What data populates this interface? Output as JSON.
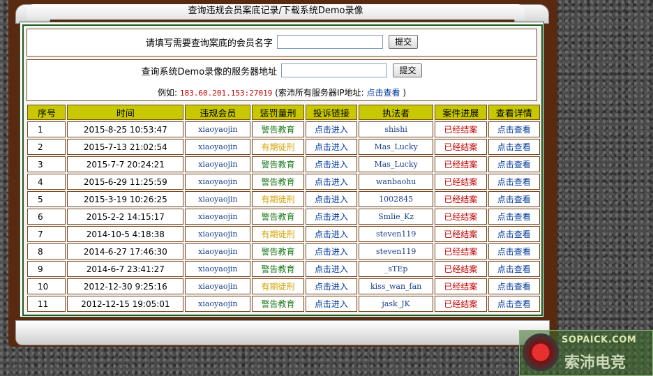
{
  "window": {
    "title": "查询违规会员案底记录/下载系统Demo录像"
  },
  "member_query": {
    "label": "请填写需要查询案底的会员名字",
    "value": "",
    "submit_label": "提交"
  },
  "demo_query": {
    "label": "查询系统Demo录像的服务器地址",
    "value": "",
    "submit_label": "提交",
    "example_prefix": "例如:",
    "example_ip": "183.60.201.153:27019",
    "example_suffix_open": "(索沛所有服务器IP地址:",
    "example_link": "点击查看",
    "example_suffix_close": ")"
  },
  "table": {
    "headers": [
      "序号",
      "时间",
      "违规会员",
      "惩罚量刑",
      "投诉链接",
      "执法者",
      "案件进展",
      "查看详情"
    ],
    "rows": [
      {
        "idx": "1",
        "time": "2015-8-25 10:53:47",
        "member": "xiaoyaojin",
        "penalty": "警告教育",
        "penalty_type": "warn",
        "complaint": "点击进入",
        "enforcer": "shishi",
        "progress": "已经结案",
        "detail": "点击查看"
      },
      {
        "idx": "2",
        "time": "2015-7-13 21:02:54",
        "member": "xiaoyaojin",
        "penalty": "有期徒刑",
        "penalty_type": "jail",
        "complaint": "点击进入",
        "enforcer": "Mas_Lucky",
        "progress": "已经结案",
        "detail": "点击查看"
      },
      {
        "idx": "3",
        "time": "2015-7-7 20:24:21",
        "member": "xiaoyaojin",
        "penalty": "警告教育",
        "penalty_type": "warn",
        "complaint": "点击进入",
        "enforcer": "Mas_Lucky",
        "progress": "已经结案",
        "detail": "点击查看"
      },
      {
        "idx": "4",
        "time": "2015-6-29 11:25:59",
        "member": "xiaoyaojin",
        "penalty": "警告教育",
        "penalty_type": "warn",
        "complaint": "点击进入",
        "enforcer": "wanbaohu",
        "progress": "已经结案",
        "detail": "点击查看"
      },
      {
        "idx": "5",
        "time": "2015-3-19 10:26:25",
        "member": "xiaoyaojin",
        "penalty": "有期徒刑",
        "penalty_type": "jail",
        "complaint": "点击进入",
        "enforcer": "1002845",
        "progress": "已经结案",
        "detail": "点击查看"
      },
      {
        "idx": "6",
        "time": "2015-2-2 14:15:17",
        "member": "xiaoyaojin",
        "penalty": "警告教育",
        "penalty_type": "warn",
        "complaint": "点击进入",
        "enforcer": "Smlie_Kz",
        "progress": "已经结案",
        "detail": "点击查看"
      },
      {
        "idx": "7",
        "time": "2014-10-5 4:18:38",
        "member": "xiaoyaojin",
        "penalty": "有期徒刑",
        "penalty_type": "jail",
        "complaint": "点击进入",
        "enforcer": "steven119",
        "progress": "已经结案",
        "detail": "点击查看"
      },
      {
        "idx": "8",
        "time": "2014-6-27 17:46:30",
        "member": "xiaoyaojin",
        "penalty": "警告教育",
        "penalty_type": "warn",
        "complaint": "点击进入",
        "enforcer": "steven119",
        "progress": "已经结案",
        "detail": "点击查看"
      },
      {
        "idx": "9",
        "time": "2014-6-7 23:41:27",
        "member": "xiaoyaojin",
        "penalty": "警告教育",
        "penalty_type": "warn",
        "complaint": "点击进入",
        "enforcer": "_sTEp",
        "progress": "已经结案",
        "detail": "点击查看"
      },
      {
        "idx": "10",
        "time": "2012-12-30 9:25:16",
        "member": "xiaoyaojin",
        "penalty": "有期徒刑",
        "penalty_type": "jail",
        "complaint": "点击进入",
        "enforcer": "kiss_wan_fan",
        "progress": "已经结案",
        "detail": "点击查看"
      },
      {
        "idx": "11",
        "time": "2012-12-15 19:05:01",
        "member": "xiaoyaojin",
        "penalty": "警告教育",
        "penalty_type": "warn",
        "complaint": "点击进入",
        "enforcer": "jask_JK",
        "progress": "已经结案",
        "detail": "点击查看"
      }
    ]
  },
  "watermark": {
    "line1": "SOPAICK.COM",
    "line2": "索沛电竞"
  },
  "colors": {
    "frame_brown": "#5a2a10",
    "header_yellow": "#c8c800",
    "warn_green": "#1d7a1d",
    "jail_yellow": "#d4a000",
    "closed_red": "#c00000",
    "link_blue": "#00369a"
  }
}
